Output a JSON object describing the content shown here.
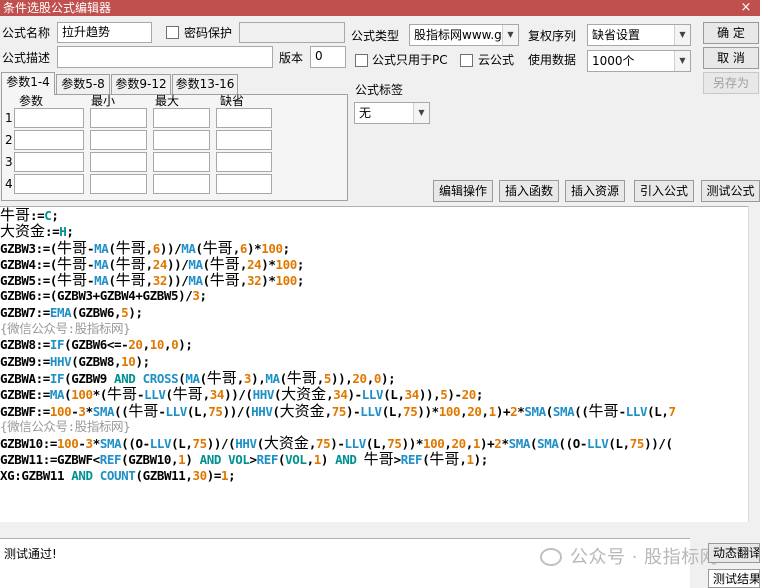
{
  "window": {
    "title": "条件选股公式编辑器",
    "close": "×"
  },
  "form": {
    "name_label": "公式名称",
    "name_value": "拉升趋势",
    "password_label": "密码保护",
    "password_value": "",
    "desc_label": "公式描述",
    "desc_value": "",
    "version_label": "版本",
    "version_value": "0",
    "type_label": "公式类型",
    "type_value": "股指标网www.g",
    "restore_label": "复权序列",
    "restore_value": "缺省设置",
    "pc_only_label": "公式只用于PC",
    "cloud_label": "云公式",
    "usage_label": "使用数据",
    "usage_value": "1000个",
    "tag_label": "公式标签",
    "tag_value": "无"
  },
  "buttons": {
    "ok": "确  定",
    "cancel": "取  消",
    "save_as": "另存为",
    "edit_ops": "编辑操作",
    "insert_fn": "插入函数",
    "insert_res": "插入资源",
    "import": "引入公式",
    "test": "测试公式"
  },
  "params": {
    "tabs": [
      "参数1-4",
      "参数5-8",
      "参数9-12",
      "参数13-16"
    ],
    "active_tab": 0,
    "headers": [
      "参数",
      "最小",
      "最大",
      "缺省"
    ],
    "rows": [
      "1",
      "2",
      "3",
      "4"
    ]
  },
  "code_lines": [
    [
      [
        "牛哥",
        "cn"
      ],
      [
        ":=",
        "op"
      ],
      [
        "C",
        "kw"
      ],
      [
        ";",
        "op"
      ]
    ],
    [
      [
        "大资金",
        "cn"
      ],
      [
        ":=",
        "op"
      ],
      [
        "H",
        "kw"
      ],
      [
        ";",
        "op"
      ]
    ],
    [
      [
        "GZBW3:=(",
        "var"
      ],
      [
        "牛哥",
        "cn"
      ],
      [
        "-",
        "op"
      ],
      [
        "MA",
        "fn"
      ],
      [
        "(",
        "op"
      ],
      [
        "牛哥",
        "cn"
      ],
      [
        ",",
        "op"
      ],
      [
        "6",
        "num"
      ],
      [
        "))/",
        "op"
      ],
      [
        "MA",
        "fn"
      ],
      [
        "(",
        "op"
      ],
      [
        "牛哥",
        "cn"
      ],
      [
        ",",
        "op"
      ],
      [
        "6",
        "num"
      ],
      [
        ")*",
        "op"
      ],
      [
        "100",
        "num"
      ],
      [
        ";",
        "op"
      ]
    ],
    [
      [
        "GZBW4:=(",
        "var"
      ],
      [
        "牛哥",
        "cn"
      ],
      [
        "-",
        "op"
      ],
      [
        "MA",
        "fn"
      ],
      [
        "(",
        "op"
      ],
      [
        "牛哥",
        "cn"
      ],
      [
        ",",
        "op"
      ],
      [
        "24",
        "num"
      ],
      [
        "))/",
        "op"
      ],
      [
        "MA",
        "fn"
      ],
      [
        "(",
        "op"
      ],
      [
        "牛哥",
        "cn"
      ],
      [
        ",",
        "op"
      ],
      [
        "24",
        "num"
      ],
      [
        ")*",
        "op"
      ],
      [
        "100",
        "num"
      ],
      [
        ";",
        "op"
      ]
    ],
    [
      [
        "GZBW5:=(",
        "var"
      ],
      [
        "牛哥",
        "cn"
      ],
      [
        "-",
        "op"
      ],
      [
        "MA",
        "fn"
      ],
      [
        "(",
        "op"
      ],
      [
        "牛哥",
        "cn"
      ],
      [
        ",",
        "op"
      ],
      [
        "32",
        "num"
      ],
      [
        "))/",
        "op"
      ],
      [
        "MA",
        "fn"
      ],
      [
        "(",
        "op"
      ],
      [
        "牛哥",
        "cn"
      ],
      [
        ",",
        "op"
      ],
      [
        "32",
        "num"
      ],
      [
        ")*",
        "op"
      ],
      [
        "100",
        "num"
      ],
      [
        ";",
        "op"
      ]
    ],
    [
      [
        "GZBW6:=(GZBW3+GZBW4+GZBW5)/",
        "var"
      ],
      [
        "3",
        "num"
      ],
      [
        ";",
        "op"
      ]
    ],
    [
      [
        "GZBW7:=",
        "var"
      ],
      [
        "EMA",
        "fn"
      ],
      [
        "(GZBW6,",
        "var"
      ],
      [
        "5",
        "num"
      ],
      [
        ");",
        "op"
      ]
    ],
    [
      [
        "{微信公众号:股指标网}",
        "cm"
      ]
    ],
    [
      [
        "GZBW8:=",
        "var"
      ],
      [
        "IF",
        "fn"
      ],
      [
        "(GZBW6<=-",
        "var"
      ],
      [
        "20",
        "num"
      ],
      [
        ",",
        "op"
      ],
      [
        "10",
        "num"
      ],
      [
        ",",
        "op"
      ],
      [
        "0",
        "num"
      ],
      [
        ");",
        "op"
      ]
    ],
    [
      [
        "GZBW9:=",
        "var"
      ],
      [
        "HHV",
        "fn"
      ],
      [
        "(GZBW8,",
        "var"
      ],
      [
        "10",
        "num"
      ],
      [
        ");",
        "op"
      ]
    ],
    [
      [
        "GZBWA:=",
        "var"
      ],
      [
        "IF",
        "fn"
      ],
      [
        "(GZBW9 ",
        "var"
      ],
      [
        "AND",
        "kw"
      ],
      [
        " ",
        "op"
      ],
      [
        "CROSS",
        "fn"
      ],
      [
        "(",
        "op"
      ],
      [
        "MA",
        "fn"
      ],
      [
        "(",
        "op"
      ],
      [
        "牛哥",
        "cn"
      ],
      [
        ",",
        "op"
      ],
      [
        "3",
        "num"
      ],
      [
        "),",
        "op"
      ],
      [
        "MA",
        "fn"
      ],
      [
        "(",
        "op"
      ],
      [
        "牛哥",
        "cn"
      ],
      [
        ",",
        "op"
      ],
      [
        "5",
        "num"
      ],
      [
        ")),",
        "op"
      ],
      [
        "20",
        "num"
      ],
      [
        ",",
        "op"
      ],
      [
        "0",
        "num"
      ],
      [
        ");",
        "op"
      ]
    ],
    [
      [
        "GZBWE:=",
        "var"
      ],
      [
        "MA",
        "fn"
      ],
      [
        "(",
        "op"
      ],
      [
        "100",
        "num"
      ],
      [
        "*(",
        "op"
      ],
      [
        "牛哥",
        "cn"
      ],
      [
        "-",
        "op"
      ],
      [
        "LLV",
        "fn"
      ],
      [
        "(",
        "op"
      ],
      [
        "牛哥",
        "cn"
      ],
      [
        ",",
        "op"
      ],
      [
        "34",
        "num"
      ],
      [
        "))/(",
        "op"
      ],
      [
        "HHV",
        "fn"
      ],
      [
        "(",
        "op"
      ],
      [
        "大资金",
        "cn"
      ],
      [
        ",",
        "op"
      ],
      [
        "34",
        "num"
      ],
      [
        ")-",
        "op"
      ],
      [
        "LLV",
        "fn"
      ],
      [
        "(L,",
        "var"
      ],
      [
        "34",
        "num"
      ],
      [
        ")),",
        "op"
      ],
      [
        "5",
        "num"
      ],
      [
        ")-",
        "op"
      ],
      [
        "20",
        "num"
      ],
      [
        ";",
        "op"
      ]
    ],
    [
      [
        "GZBWF:=",
        "var"
      ],
      [
        "100",
        "num"
      ],
      [
        "-",
        "op"
      ],
      [
        "3",
        "num"
      ],
      [
        "*",
        "op"
      ],
      [
        "SMA",
        "fn"
      ],
      [
        "((",
        "op"
      ],
      [
        "牛哥",
        "cn"
      ],
      [
        "-",
        "op"
      ],
      [
        "LLV",
        "fn"
      ],
      [
        "(L,",
        "var"
      ],
      [
        "75",
        "num"
      ],
      [
        "))/(",
        "op"
      ],
      [
        "HHV",
        "fn"
      ],
      [
        "(",
        "op"
      ],
      [
        "大资金",
        "cn"
      ],
      [
        ",",
        "op"
      ],
      [
        "75",
        "num"
      ],
      [
        ")-",
        "op"
      ],
      [
        "LLV",
        "fn"
      ],
      [
        "(L,",
        "var"
      ],
      [
        "75",
        "num"
      ],
      [
        "))*",
        "op"
      ],
      [
        "100",
        "num"
      ],
      [
        ",",
        "op"
      ],
      [
        "20",
        "num"
      ],
      [
        ",",
        "op"
      ],
      [
        "1",
        "num"
      ],
      [
        ")+",
        "op"
      ],
      [
        "2",
        "num"
      ],
      [
        "*",
        "op"
      ],
      [
        "SMA",
        "fn"
      ],
      [
        "(",
        "op"
      ],
      [
        "SMA",
        "fn"
      ],
      [
        "((",
        "op"
      ],
      [
        "牛哥",
        "cn"
      ],
      [
        "-",
        "op"
      ],
      [
        "LLV",
        "fn"
      ],
      [
        "(L,",
        "var"
      ],
      [
        "7",
        "num"
      ]
    ],
    [
      [
        "{微信公众号:股指标网}",
        "cm"
      ]
    ],
    [
      [
        "GZBW10:=",
        "var"
      ],
      [
        "100",
        "num"
      ],
      [
        "-",
        "op"
      ],
      [
        "3",
        "num"
      ],
      [
        "*",
        "op"
      ],
      [
        "SMA",
        "fn"
      ],
      [
        "((O-",
        "var"
      ],
      [
        "LLV",
        "fn"
      ],
      [
        "(L,",
        "var"
      ],
      [
        "75",
        "num"
      ],
      [
        "))/(",
        "op"
      ],
      [
        "HHV",
        "fn"
      ],
      [
        "(",
        "op"
      ],
      [
        "大资金",
        "cn"
      ],
      [
        ",",
        "op"
      ],
      [
        "75",
        "num"
      ],
      [
        ")-",
        "op"
      ],
      [
        "LLV",
        "fn"
      ],
      [
        "(L,",
        "var"
      ],
      [
        "75",
        "num"
      ],
      [
        "))*",
        "op"
      ],
      [
        "100",
        "num"
      ],
      [
        ",",
        "op"
      ],
      [
        "20",
        "num"
      ],
      [
        ",",
        "op"
      ],
      [
        "1",
        "num"
      ],
      [
        ")+",
        "op"
      ],
      [
        "2",
        "num"
      ],
      [
        "*",
        "op"
      ],
      [
        "SMA",
        "fn"
      ],
      [
        "(",
        "op"
      ],
      [
        "SMA",
        "fn"
      ],
      [
        "((O-",
        "var"
      ],
      [
        "LLV",
        "fn"
      ],
      [
        "(L,",
        "var"
      ],
      [
        "75",
        "num"
      ],
      [
        "))/(",
        "op"
      ]
    ],
    [
      [
        "GZBW11:=GZBWF<",
        "var"
      ],
      [
        "REF",
        "fn"
      ],
      [
        "(GZBW10,",
        "var"
      ],
      [
        "1",
        "num"
      ],
      [
        ") ",
        "op"
      ],
      [
        "AND",
        "kw"
      ],
      [
        " ",
        "op"
      ],
      [
        "VOL",
        "kw"
      ],
      [
        ">",
        "op"
      ],
      [
        "REF",
        "fn"
      ],
      [
        "(",
        "op"
      ],
      [
        "VOL",
        "kw"
      ],
      [
        ",",
        "op"
      ],
      [
        "1",
        "num"
      ],
      [
        ") ",
        "op"
      ],
      [
        "AND",
        "kw"
      ],
      [
        " ",
        "op"
      ],
      [
        "牛哥",
        "cn"
      ],
      [
        ">",
        "op"
      ],
      [
        "REF",
        "fn"
      ],
      [
        "(",
        "op"
      ],
      [
        "牛哥",
        "cn"
      ],
      [
        ",",
        "op"
      ],
      [
        "1",
        "num"
      ],
      [
        ");",
        "op"
      ]
    ],
    [
      [
        "XG:GZBW11 ",
        "var"
      ],
      [
        "AND",
        "kw"
      ],
      [
        " ",
        "op"
      ],
      [
        "COUNT",
        "fn"
      ],
      [
        "(GZBW11,",
        "var"
      ],
      [
        "30",
        "num"
      ],
      [
        ")=",
        "op"
      ],
      [
        "1",
        "num"
      ],
      [
        ";",
        "op"
      ]
    ]
  ],
  "status": {
    "text": "测试通过!",
    "watermark": "公众号 · 股指标网",
    "dynamic_translate": "动态翻译",
    "test_result": "测试结果"
  }
}
